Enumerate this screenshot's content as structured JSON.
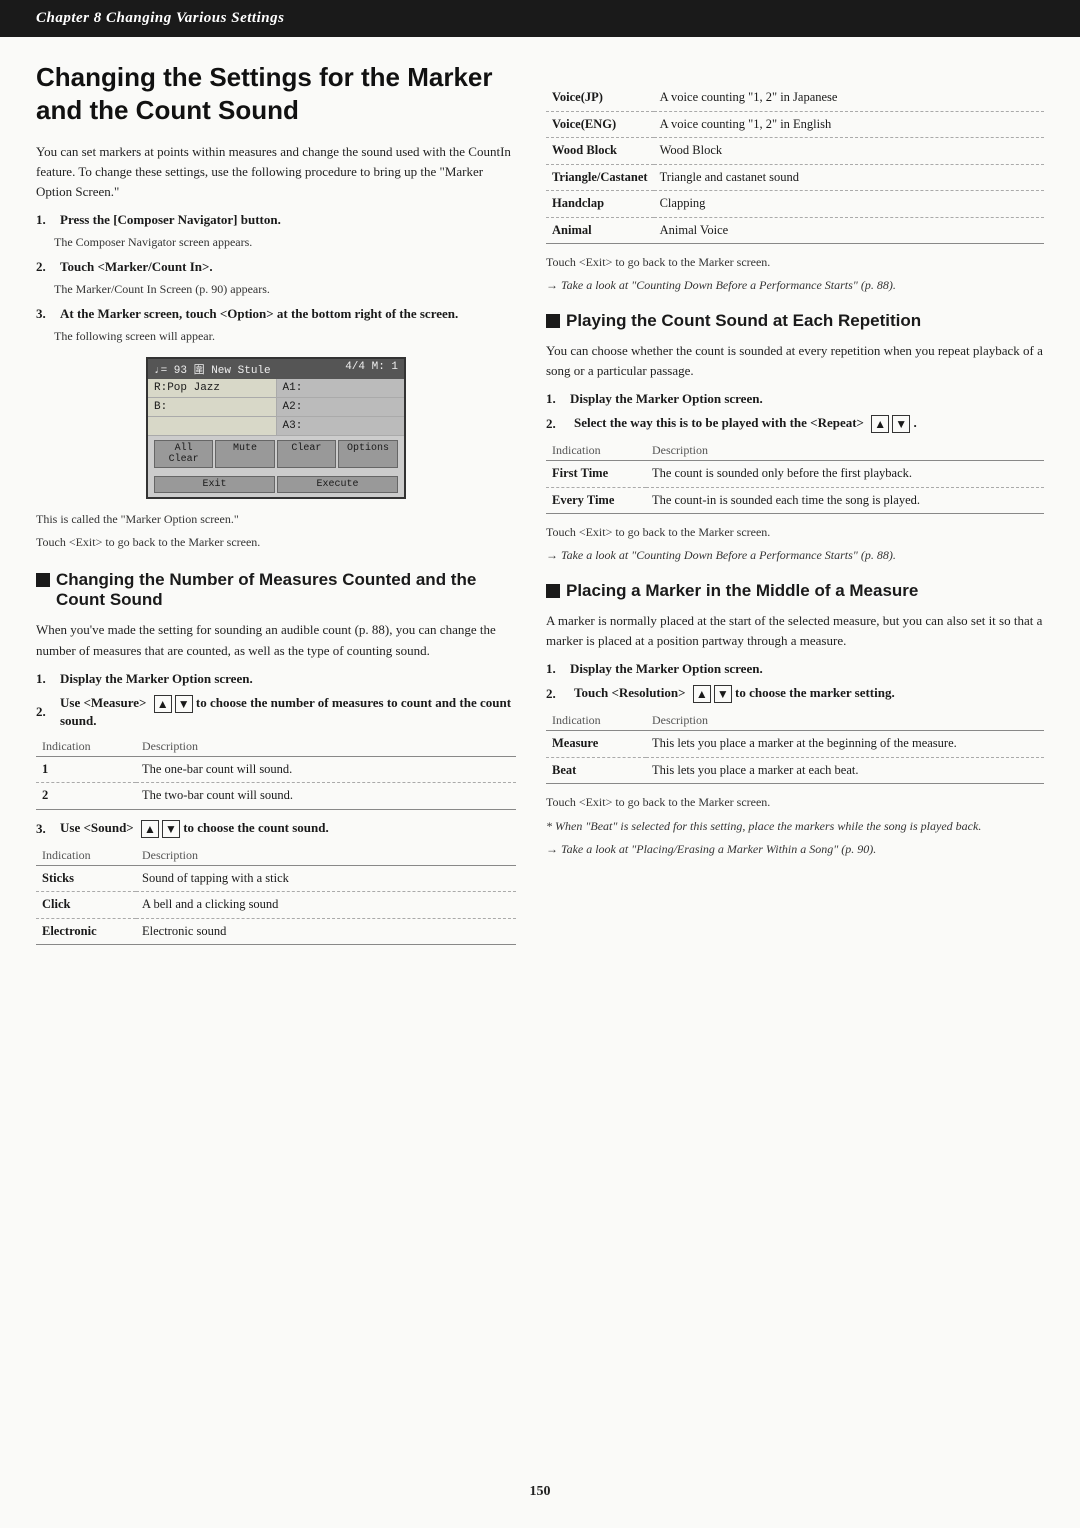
{
  "chapter_bar": "Chapter 8  Changing Various Settings",
  "main_title": "Changing the Settings for the Marker and the Count Sound",
  "intro_text": "You can set markers at points within measures and change the sound used with the CountIn feature. To change these settings, use the following procedure to bring up the \"Marker Option Screen.\"",
  "steps_main": [
    {
      "num": "1.",
      "text": "Press the [Composer Navigator] button.",
      "sub": "The Composer Navigator screen appears."
    },
    {
      "num": "2.",
      "text": "Touch <Marker/Count In>.",
      "sub": "The Marker/Count In Screen (p. 90) appears."
    },
    {
      "num": "3.",
      "text": "At the Marker screen, touch <Option> at the bottom right of the screen.",
      "sub": "The following screen will appear."
    }
  ],
  "screen": {
    "topbar_left": "♩= 93  圍  New Stule",
    "topbar_right": "4/4  M: 1",
    "row1_left": "R:Pop Jazz",
    "row1_right": "A1:",
    "row2_left": "B:",
    "row2_right": "A2:",
    "row3_right": "A3:",
    "btn1": "All Clear",
    "btn2": "Mute",
    "btn3": "Clear",
    "btn4": "Options",
    "btn5": "Exit",
    "btn6": "Execute"
  },
  "screen_caption1": "This is called the \"Marker Option screen.\"",
  "screen_caption2": "Touch <Exit> to go back to the Marker screen.",
  "section2_title": "Changing the Number of Measures Counted and the Count Sound",
  "section2_body": "When you've made the setting for sounding an audible count (p. 88), you can change the number of measures that are counted, as well as the type of counting sound.",
  "step2_1": "Display the Marker Option screen.",
  "step2_2_text": "Use <Measure>",
  "step2_2_arrows": true,
  "step2_2_rest": " to choose the number of measures to count and the count sound.",
  "table2_headers": [
    "Indication",
    "Description"
  ],
  "table2_rows": [
    {
      "ind": "1",
      "desc": "The one-bar count will sound."
    },
    {
      "ind": "2",
      "desc": "The two-bar count will sound."
    }
  ],
  "step2_3_text": "Use <Sound>",
  "step2_3_rest": " to choose the count sound.",
  "table3_headers": [
    "Indication",
    "Description"
  ],
  "table3_rows": [
    {
      "ind": "Sticks",
      "desc": "Sound of tapping with a stick"
    },
    {
      "ind": "Click",
      "desc": "A bell and a clicking sound"
    },
    {
      "ind": "Electronic",
      "desc": "Electronic sound"
    },
    {
      "ind": "Voice(JP)",
      "desc": "A voice counting \"1, 2\" in Japanese"
    },
    {
      "ind": "Voice(ENG)",
      "desc": "A voice counting \"1, 2\" in English"
    },
    {
      "ind": "Wood Block",
      "desc": "Wood Block"
    },
    {
      "ind": "Triangle/Castanet",
      "desc": "Triangle and castanet sound"
    },
    {
      "ind": "Handclap",
      "desc": "Clapping"
    },
    {
      "ind": "Animal",
      "desc": "Animal Voice"
    }
  ],
  "note_exit_1": "Touch <Exit> to go back to the Marker screen.",
  "arrow_ref_1": "Take a look at \"Counting Down Before a Performance Starts\" (p. 88).",
  "section3_title": "Playing the Count Sound at Each Repetition",
  "section3_body": "You can choose whether the count is sounded at every repetition when you repeat playback of a song or a particular passage.",
  "step3_1": "Display the Marker Option screen.",
  "step3_2_text": "Select the way this is to be played with the <Repeat>",
  "step3_2_rest": ".",
  "table4_headers": [
    "Indication",
    "Description"
  ],
  "table4_rows": [
    {
      "ind": "First Time",
      "desc": "The count is sounded only before the first playback."
    },
    {
      "ind": "Every Time",
      "desc": "The count-in is sounded each time the song is played."
    }
  ],
  "note_exit_2": "Touch <Exit> to go back to the Marker screen.",
  "arrow_ref_2": "Take a look at \"Counting Down Before a Performance Starts\" (p. 88).",
  "section4_title": "Placing a Marker in the Middle of a Measure",
  "section4_body": "A marker is normally placed at the start of the selected measure, but you can also set it so that a marker is placed at a position partway through a measure.",
  "step4_1": "Display the Marker Option screen.",
  "step4_2_text": "Touch <Resolution>",
  "step4_2_rest": "to choose the marker setting.",
  "table5_headers": [
    "Indication",
    "Description"
  ],
  "table5_rows": [
    {
      "ind": "Measure",
      "desc": "This lets you place a marker at the beginning of the measure."
    },
    {
      "ind": "Beat",
      "desc": "This lets you place a marker at each beat."
    }
  ],
  "note_exit_3": "Touch <Exit> to go back to the Marker screen.",
  "note_star": "When \"Beat\" is selected for this setting, place the markers while the song is played back.",
  "arrow_ref_3": "Take a look at \"Placing/Erasing a Marker Within a Song\" (p. 90).",
  "page_number": "150"
}
